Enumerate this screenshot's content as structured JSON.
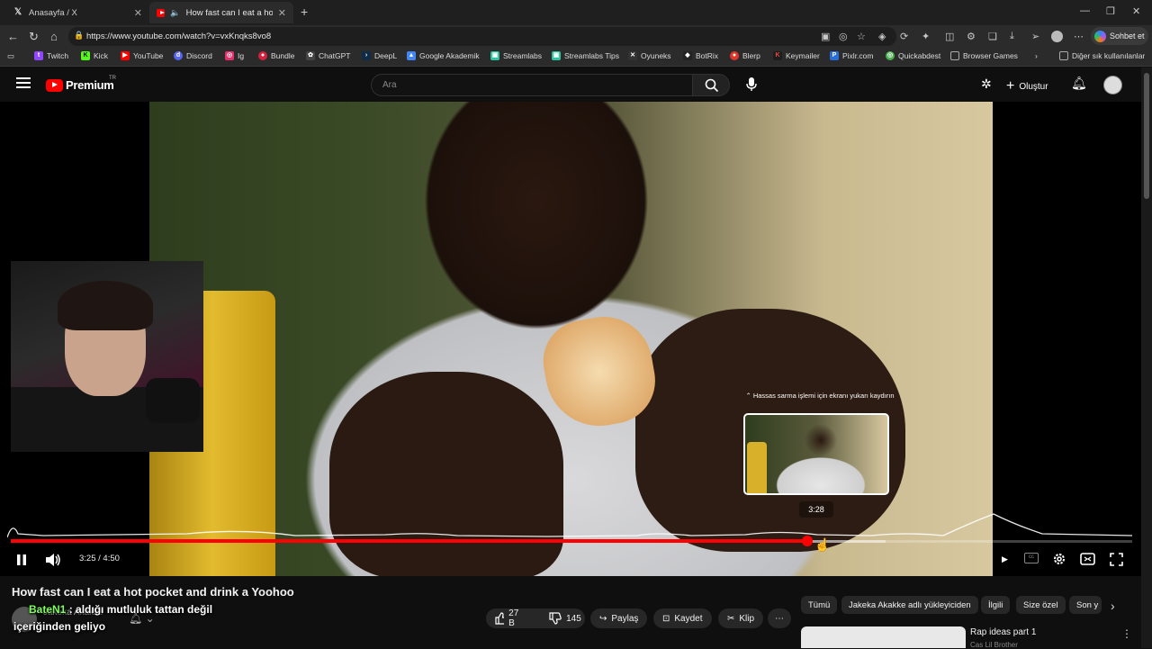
{
  "browser": {
    "tabs": [
      {
        "title": "Anasayfa / X",
        "active": false
      },
      {
        "title": "How fast can I eat a hot pock",
        "active": true
      }
    ],
    "url": "https://www.youtube.com/watch?v=vxKnqks8vo8",
    "copilot_label": "Sohbet et",
    "bookmarks": [
      "Twitch",
      "Kick",
      "YouTube",
      "Discord",
      "Ig",
      "Bundle",
      "ChatGPT",
      "DeepL",
      "Google Akademik",
      "Streamlabs",
      "Streamlabs Tips",
      "Oyuneks",
      "BotRix",
      "Blerp",
      "Keymailer",
      "Pixlr.com",
      "Quickabdest",
      "Browser Games"
    ],
    "other_bookmarks": "Diğer sık kullanılanlar"
  },
  "youtube": {
    "logo_text": "Premium",
    "region": "TR",
    "search_placeholder": "Ara",
    "create_label": "Oluştur"
  },
  "player": {
    "current_time": "3:25 / 4:50",
    "progress_fraction": 0.71,
    "buffer_fraction": 0.78,
    "hover_hint": "Hassas sarma işlemi için ekranı yukarı kaydırın",
    "hover_time": "3:28"
  },
  "video": {
    "title": "How fast can I eat a hot pocket and drink a Yoohoo",
    "channel": "Jakeka Akakke",
    "likes": "27 B",
    "dislikes": "145",
    "share": "Paylaş",
    "save": "Kaydet",
    "clip": "Klip"
  },
  "overlay_chat": {
    "user": "BateN1",
    "message_line1": ": aldığı mutluluk tattan değil",
    "message_line2": "içeriğinden geliyo"
  },
  "chips": [
    "Tümü",
    "Jakeka Akakke adlı yükleyiciden",
    "İlgili",
    "Size özel",
    "Son y"
  ],
  "recommendation": {
    "title": "Rap ideas part 1",
    "channel": "Cas Lil Brother"
  },
  "colors": {
    "accent": "#ff0000",
    "chat_user": "#7cff5a"
  }
}
